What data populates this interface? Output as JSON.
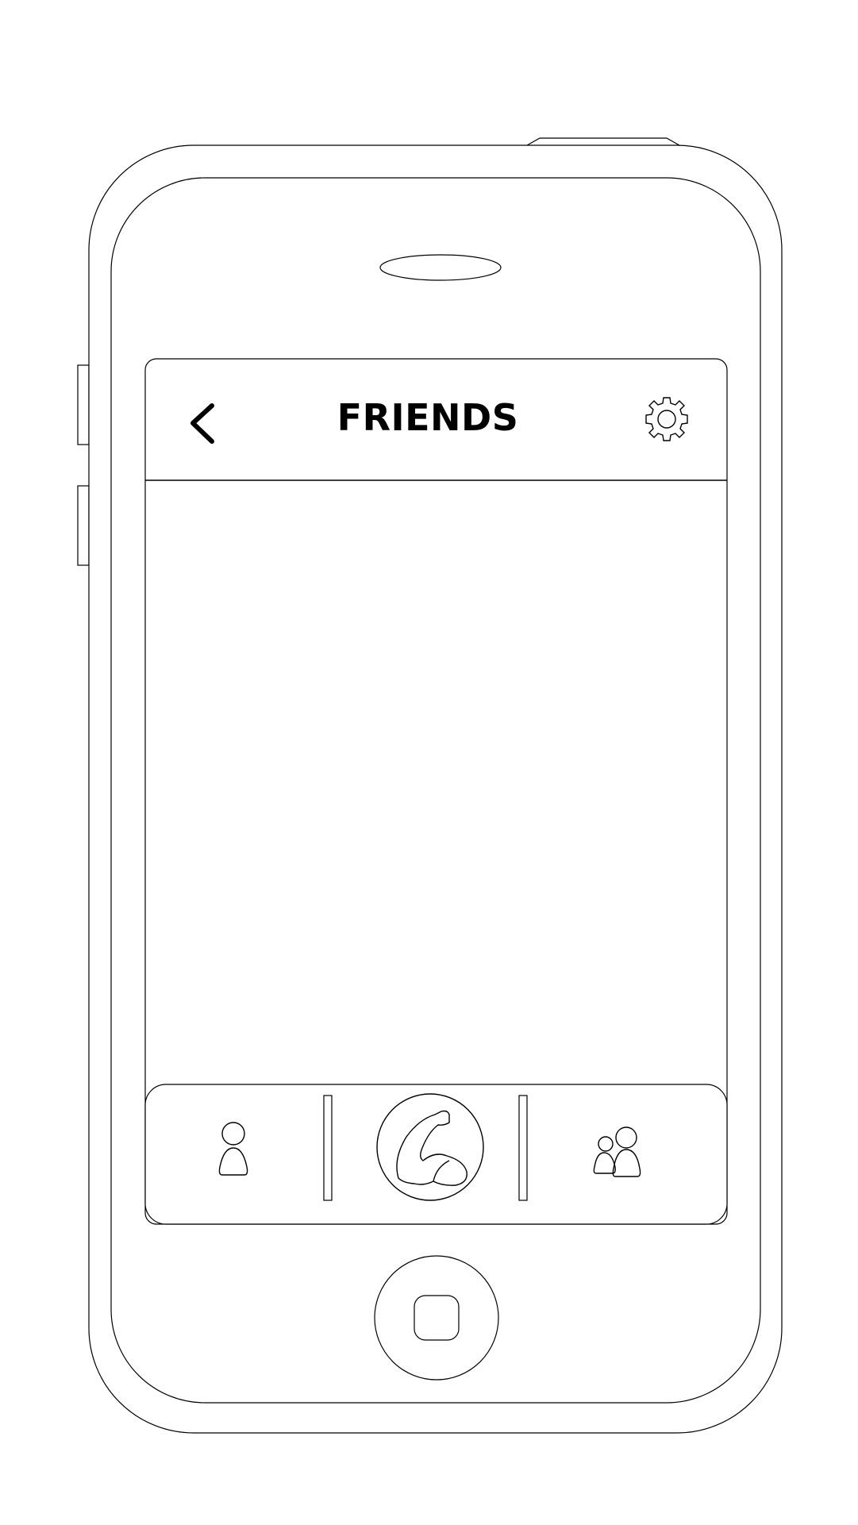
{
  "header": {
    "title": "FRIENDS",
    "back_icon": "chevron-left-icon",
    "settings_icon": "gear-icon"
  },
  "tab_bar": {
    "items": [
      {
        "icon": "person-icon"
      },
      {
        "icon": "flexed-bicep-icon"
      },
      {
        "icon": "group-icon"
      }
    ]
  },
  "colors": {
    "outline": "#000000",
    "background": "#ffffff"
  }
}
